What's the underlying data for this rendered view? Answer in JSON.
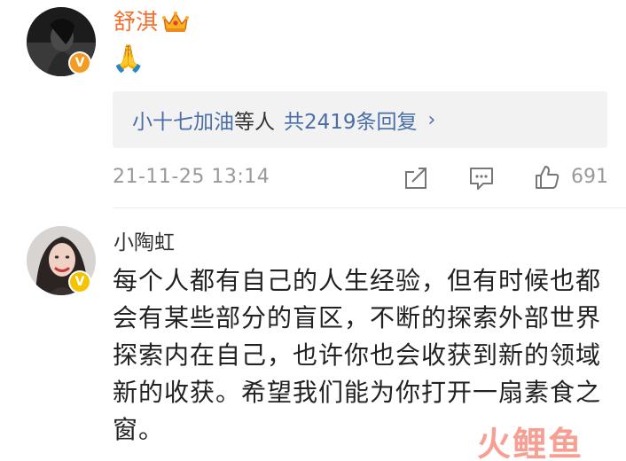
{
  "comments": [
    {
      "username": "舒淇",
      "text": "🙏",
      "replies": {
        "user": "小十七加油",
        "mid": "等人",
        "total": "共2419条回复",
        "chevron": "›"
      },
      "timestamp": "21-11-25 13:14",
      "likes": "691",
      "verified_color": "#f5a623",
      "name_color": "#f56f2d"
    },
    {
      "username": "小陶虹",
      "text": "每个人都有自己的人生经验，但有时候也都会有某些部分的盲区，不断的探索外部世界探索内在自己，也许你也会收获到新的领域新的收获。希望我们能为你打开一扇素食之窗。",
      "verified_color": "#f5c400"
    }
  ],
  "icons": {
    "crown": "crown-icon",
    "share": "share-icon",
    "comment": "comment-icon",
    "like": "thumbs-up-icon"
  },
  "watermark": "火鲤鱼"
}
